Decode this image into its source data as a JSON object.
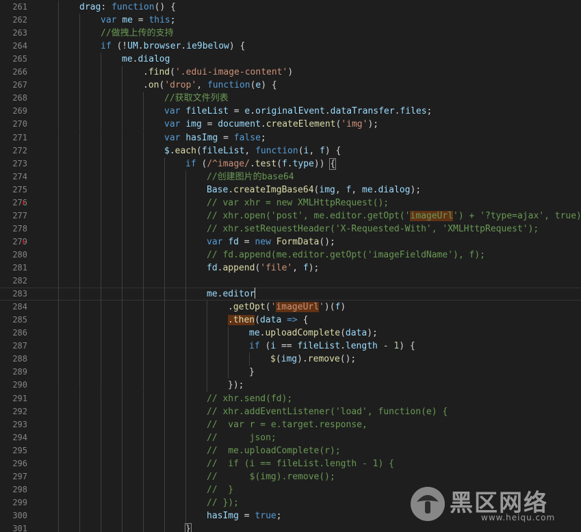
{
  "colors": {
    "background": "#1e1e1e",
    "keyword": "#569cd6",
    "function": "#dcdcaa",
    "variable": "#9cdcfe",
    "string": "#ce9178",
    "comment": "#6a9955",
    "number": "#b5cea8",
    "plain": "#d4d4d4",
    "line_number": "#858585",
    "highlight": "#613214"
  },
  "lines": [
    {
      "num": "261",
      "indent": 2,
      "tokens": [
        [
          "var",
          "drag"
        ],
        [
          "plain",
          ": "
        ],
        [
          "kw",
          "function"
        ],
        [
          "plain",
          "() {"
        ]
      ]
    },
    {
      "num": "262",
      "indent": 3,
      "tokens": [
        [
          "kw",
          "var"
        ],
        [
          "plain",
          " "
        ],
        [
          "var",
          "me"
        ],
        [
          "plain",
          " = "
        ],
        [
          "kw",
          "this"
        ],
        [
          "plain",
          ";"
        ]
      ]
    },
    {
      "num": "263",
      "indent": 3,
      "tokens": [
        [
          "cm",
          "//做拽上传的支持"
        ]
      ]
    },
    {
      "num": "264",
      "indent": 3,
      "tokens": [
        [
          "kw",
          "if"
        ],
        [
          "plain",
          " (!"
        ],
        [
          "var",
          "UM"
        ],
        [
          "plain",
          "."
        ],
        [
          "var",
          "browser"
        ],
        [
          "plain",
          "."
        ],
        [
          "var",
          "ie9below"
        ],
        [
          "plain",
          ") {"
        ]
      ]
    },
    {
      "num": "265",
      "indent": 4,
      "tokens": [
        [
          "var",
          "me"
        ],
        [
          "plain",
          "."
        ],
        [
          "var",
          "dialog"
        ]
      ]
    },
    {
      "num": "266",
      "indent": 5,
      "tokens": [
        [
          "plain",
          "."
        ],
        [
          "fn",
          "find"
        ],
        [
          "plain",
          "("
        ],
        [
          "str",
          "'.edui-image-content'"
        ],
        [
          "plain",
          ")"
        ]
      ]
    },
    {
      "num": "267",
      "indent": 5,
      "tokens": [
        [
          "plain",
          "."
        ],
        [
          "fn",
          "on"
        ],
        [
          "plain",
          "("
        ],
        [
          "str",
          "'drop'"
        ],
        [
          "plain",
          ", "
        ],
        [
          "kw",
          "function"
        ],
        [
          "plain",
          "("
        ],
        [
          "var",
          "e"
        ],
        [
          "plain",
          ") {"
        ]
      ]
    },
    {
      "num": "268",
      "indent": 6,
      "tokens": [
        [
          "cm",
          "//获取文件列表"
        ]
      ]
    },
    {
      "num": "269",
      "indent": 6,
      "tokens": [
        [
          "kw",
          "var"
        ],
        [
          "plain",
          " "
        ],
        [
          "var",
          "fileList"
        ],
        [
          "plain",
          " = "
        ],
        [
          "var",
          "e"
        ],
        [
          "plain",
          "."
        ],
        [
          "var",
          "originalEvent"
        ],
        [
          "plain",
          "."
        ],
        [
          "var",
          "dataTransfer"
        ],
        [
          "plain",
          "."
        ],
        [
          "var",
          "files"
        ],
        [
          "plain",
          ";"
        ]
      ]
    },
    {
      "num": "270",
      "indent": 6,
      "tokens": [
        [
          "kw",
          "var"
        ],
        [
          "plain",
          " "
        ],
        [
          "var",
          "img"
        ],
        [
          "plain",
          " = "
        ],
        [
          "var",
          "document"
        ],
        [
          "plain",
          "."
        ],
        [
          "fn",
          "createElement"
        ],
        [
          "plain",
          "("
        ],
        [
          "str",
          "'img'"
        ],
        [
          "plain",
          ");"
        ]
      ]
    },
    {
      "num": "271",
      "indent": 6,
      "tokens": [
        [
          "kw",
          "var"
        ],
        [
          "plain",
          " "
        ],
        [
          "var",
          "hasImg"
        ],
        [
          "plain",
          " = "
        ],
        [
          "kw",
          "false"
        ],
        [
          "plain",
          ";"
        ]
      ]
    },
    {
      "num": "272",
      "indent": 6,
      "tokens": [
        [
          "var",
          "$"
        ],
        [
          "plain",
          "."
        ],
        [
          "fn",
          "each"
        ],
        [
          "plain",
          "("
        ],
        [
          "var",
          "fileList"
        ],
        [
          "plain",
          ", "
        ],
        [
          "kw",
          "function"
        ],
        [
          "plain",
          "("
        ],
        [
          "var",
          "i"
        ],
        [
          "plain",
          ", "
        ],
        [
          "var",
          "f"
        ],
        [
          "plain",
          ") {"
        ]
      ]
    },
    {
      "num": "273",
      "indent": 7,
      "tokens": [
        [
          "kw",
          "if"
        ],
        [
          "plain",
          " ("
        ],
        [
          "str",
          "/^image/"
        ],
        [
          "plain",
          "."
        ],
        [
          "fn",
          "test"
        ],
        [
          "plain",
          "("
        ],
        [
          "var",
          "f"
        ],
        [
          "plain",
          "."
        ],
        [
          "var",
          "type"
        ],
        [
          "plain",
          ")) "
        ],
        [
          "box",
          "{"
        ]
      ]
    },
    {
      "num": "274",
      "indent": 8,
      "tokens": [
        [
          "cm",
          "//创建图片的base64"
        ]
      ]
    },
    {
      "num": "275",
      "indent": 8,
      "tokens": [
        [
          "var",
          "Base"
        ],
        [
          "plain",
          "."
        ],
        [
          "fn",
          "createImgBase64"
        ],
        [
          "plain",
          "("
        ],
        [
          "var",
          "img"
        ],
        [
          "plain",
          ", "
        ],
        [
          "var",
          "f"
        ],
        [
          "plain",
          ", "
        ],
        [
          "var",
          "me"
        ],
        [
          "plain",
          "."
        ],
        [
          "var",
          "dialog"
        ],
        [
          "plain",
          ");"
        ]
      ]
    },
    {
      "num": "276",
      "indent": 8,
      "marker": true,
      "tokens": [
        [
          "cm",
          "// var xhr = new XMLHttpRequest();"
        ]
      ]
    },
    {
      "num": "277",
      "indent": 8,
      "tokens": [
        [
          "cm",
          "// xhr.open('post', me.editor.getOpt('"
        ],
        [
          "cmhl",
          "imageUrl"
        ],
        [
          "cm",
          "') + '?type=ajax', true);"
        ]
      ]
    },
    {
      "num": "278",
      "indent": 8,
      "tokens": [
        [
          "cm",
          "// xhr.setRequestHeader('X-Requested-With', 'XMLHttpRequest');"
        ]
      ]
    },
    {
      "num": "279",
      "indent": 8,
      "marker": true,
      "tokens": [
        [
          "kw",
          "var"
        ],
        [
          "plain",
          " "
        ],
        [
          "var",
          "fd"
        ],
        [
          "plain",
          " = "
        ],
        [
          "kw",
          "new"
        ],
        [
          "plain",
          " "
        ],
        [
          "fn",
          "FormData"
        ],
        [
          "plain",
          "();"
        ]
      ]
    },
    {
      "num": "280",
      "indent": 8,
      "tokens": [
        [
          "cm",
          "// fd.append(me.editor.getOpt('imageFieldName'), f);"
        ]
      ]
    },
    {
      "num": "281",
      "indent": 8,
      "tokens": [
        [
          "var",
          "fd"
        ],
        [
          "plain",
          "."
        ],
        [
          "fn",
          "append"
        ],
        [
          "plain",
          "("
        ],
        [
          "str",
          "'file'"
        ],
        [
          "plain",
          ", "
        ],
        [
          "var",
          "f"
        ],
        [
          "plain",
          ");"
        ]
      ]
    },
    {
      "num": "282",
      "indent": 8,
      "tokens": []
    },
    {
      "num": "283",
      "indent": 8,
      "cursor": true,
      "tokens": [
        [
          "var",
          "me"
        ],
        [
          "plain",
          "."
        ],
        [
          "var",
          "editor"
        ],
        [
          "caret",
          ""
        ]
      ]
    },
    {
      "num": "284",
      "indent": 9,
      "tokens": [
        [
          "plain",
          "."
        ],
        [
          "fn",
          "getOpt"
        ],
        [
          "plain",
          "("
        ],
        [
          "str",
          "'"
        ],
        [
          "strhl",
          "imageUrl"
        ],
        [
          "str",
          "'"
        ],
        [
          "plain",
          ")("
        ],
        [
          "var",
          "f"
        ],
        [
          "plain",
          ")"
        ]
      ]
    },
    {
      "num": "285",
      "indent": 9,
      "tokens": [
        [
          "hl",
          "."
        ],
        [
          "fnhl",
          "then"
        ],
        [
          "plain",
          "("
        ],
        [
          "var",
          "data"
        ],
        [
          "plain",
          " "
        ],
        [
          "kw",
          "=>"
        ],
        [
          "plain",
          " {"
        ]
      ]
    },
    {
      "num": "286",
      "indent": 10,
      "tokens": [
        [
          "var",
          "me"
        ],
        [
          "plain",
          "."
        ],
        [
          "fn",
          "uploadComplete"
        ],
        [
          "plain",
          "("
        ],
        [
          "var",
          "data"
        ],
        [
          "plain",
          ");"
        ]
      ]
    },
    {
      "num": "287",
      "indent": 10,
      "tokens": [
        [
          "kw",
          "if"
        ],
        [
          "plain",
          " ("
        ],
        [
          "var",
          "i"
        ],
        [
          "plain",
          " == "
        ],
        [
          "var",
          "fileList"
        ],
        [
          "plain",
          "."
        ],
        [
          "var",
          "length"
        ],
        [
          "plain",
          " - "
        ],
        [
          "num",
          "1"
        ],
        [
          "plain",
          ") {"
        ]
      ]
    },
    {
      "num": "288",
      "indent": 11,
      "tokens": [
        [
          "fn",
          "$"
        ],
        [
          "plain",
          "("
        ],
        [
          "var",
          "img"
        ],
        [
          "plain",
          ")."
        ],
        [
          "fn",
          "remove"
        ],
        [
          "plain",
          "();"
        ]
      ]
    },
    {
      "num": "289",
      "indent": 10,
      "tokens": [
        [
          "plain",
          "}"
        ]
      ]
    },
    {
      "num": "290",
      "indent": 9,
      "tokens": [
        [
          "plain",
          "});"
        ]
      ]
    },
    {
      "num": "291",
      "indent": 8,
      "tokens": [
        [
          "cm",
          "// xhr.send(fd);"
        ]
      ]
    },
    {
      "num": "292",
      "indent": 8,
      "tokens": [
        [
          "cm",
          "// xhr.addEventListener('load', function(e) {"
        ]
      ]
    },
    {
      "num": "293",
      "indent": 8,
      "tokens": [
        [
          "cm",
          "//  var r = e.target.response,"
        ]
      ]
    },
    {
      "num": "294",
      "indent": 8,
      "tokens": [
        [
          "cm",
          "//      json;"
        ]
      ]
    },
    {
      "num": "295",
      "indent": 8,
      "tokens": [
        [
          "cm",
          "//  me.uploadComplete(r);"
        ]
      ]
    },
    {
      "num": "296",
      "indent": 8,
      "tokens": [
        [
          "cm",
          "//  if (i == fileList.length - 1) {"
        ]
      ]
    },
    {
      "num": "297",
      "indent": 8,
      "tokens": [
        [
          "cm",
          "//      $(img).remove();"
        ]
      ]
    },
    {
      "num": "298",
      "indent": 8,
      "tokens": [
        [
          "cm",
          "//  }"
        ]
      ]
    },
    {
      "num": "299",
      "indent": 8,
      "tokens": [
        [
          "cm",
          "// });"
        ]
      ]
    },
    {
      "num": "300",
      "indent": 8,
      "tokens": [
        [
          "var",
          "hasImg"
        ],
        [
          "plain",
          " = "
        ],
        [
          "kw",
          "true"
        ],
        [
          "plain",
          ";"
        ]
      ]
    },
    {
      "num": "301",
      "indent": 7,
      "tokens": [
        [
          "box",
          "}"
        ]
      ]
    }
  ],
  "watermark": {
    "title": "黑区网络",
    "url": "www.heiqu.com"
  }
}
